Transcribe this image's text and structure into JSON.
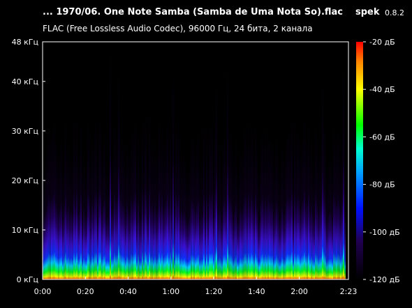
{
  "header": {
    "title": "... 1970/06. One Note Samba (Samba de Uma Nota So).flac",
    "app_name": "spek",
    "app_version": "0.8.2",
    "subtitle": "FLAC (Free Lossless Audio Codec), 96000 Гц, 24 бита, 2 канала"
  },
  "chart_data": {
    "type": "heatmap",
    "title": "... 1970/06. One Note Samba (Samba de Uma Nota So).flac",
    "subtitle": "FLAC (Free Lossless Audio Codec), 96000 Гц, 24 бита, 2 канала",
    "duration_seconds": 143,
    "max_frequency_khz": 48,
    "x_ticks": [
      {
        "label": "0:00",
        "value": 0
      },
      {
        "label": "0:20",
        "value": 20
      },
      {
        "label": "0:40",
        "value": 40
      },
      {
        "label": "1:00",
        "value": 60
      },
      {
        "label": "1:20",
        "value": 80
      },
      {
        "label": "1:40",
        "value": 100
      },
      {
        "label": "2:00",
        "value": 120
      },
      {
        "label": "2:23",
        "value": 143
      }
    ],
    "y_ticks": [
      {
        "label": "0 кГц",
        "value": 0
      },
      {
        "label": "10 кГц",
        "value": 10
      },
      {
        "label": "20 кГц",
        "value": 20
      },
      {
        "label": "30 кГц",
        "value": 30
      },
      {
        "label": "40 кГц",
        "value": 40
      },
      {
        "label": "48 кГц",
        "value": 48
      }
    ],
    "colorbar": {
      "range_db": [
        -120,
        -20
      ],
      "ticks": [
        {
          "label": "-20 дБ",
          "value": -20
        },
        {
          "label": "-40 дБ",
          "value": -40
        },
        {
          "label": "-60 дБ",
          "value": -60
        },
        {
          "label": "-80 дБ",
          "value": -80
        },
        {
          "label": "-100 дБ",
          "value": -100
        },
        {
          "label": "-120 дБ",
          "value": -120
        }
      ],
      "colors": [
        "#ffffff",
        "#ff0000",
        "#ffff00",
        "#00ff00",
        "#00ffff",
        "#0000ff",
        "#000000"
      ]
    }
  }
}
